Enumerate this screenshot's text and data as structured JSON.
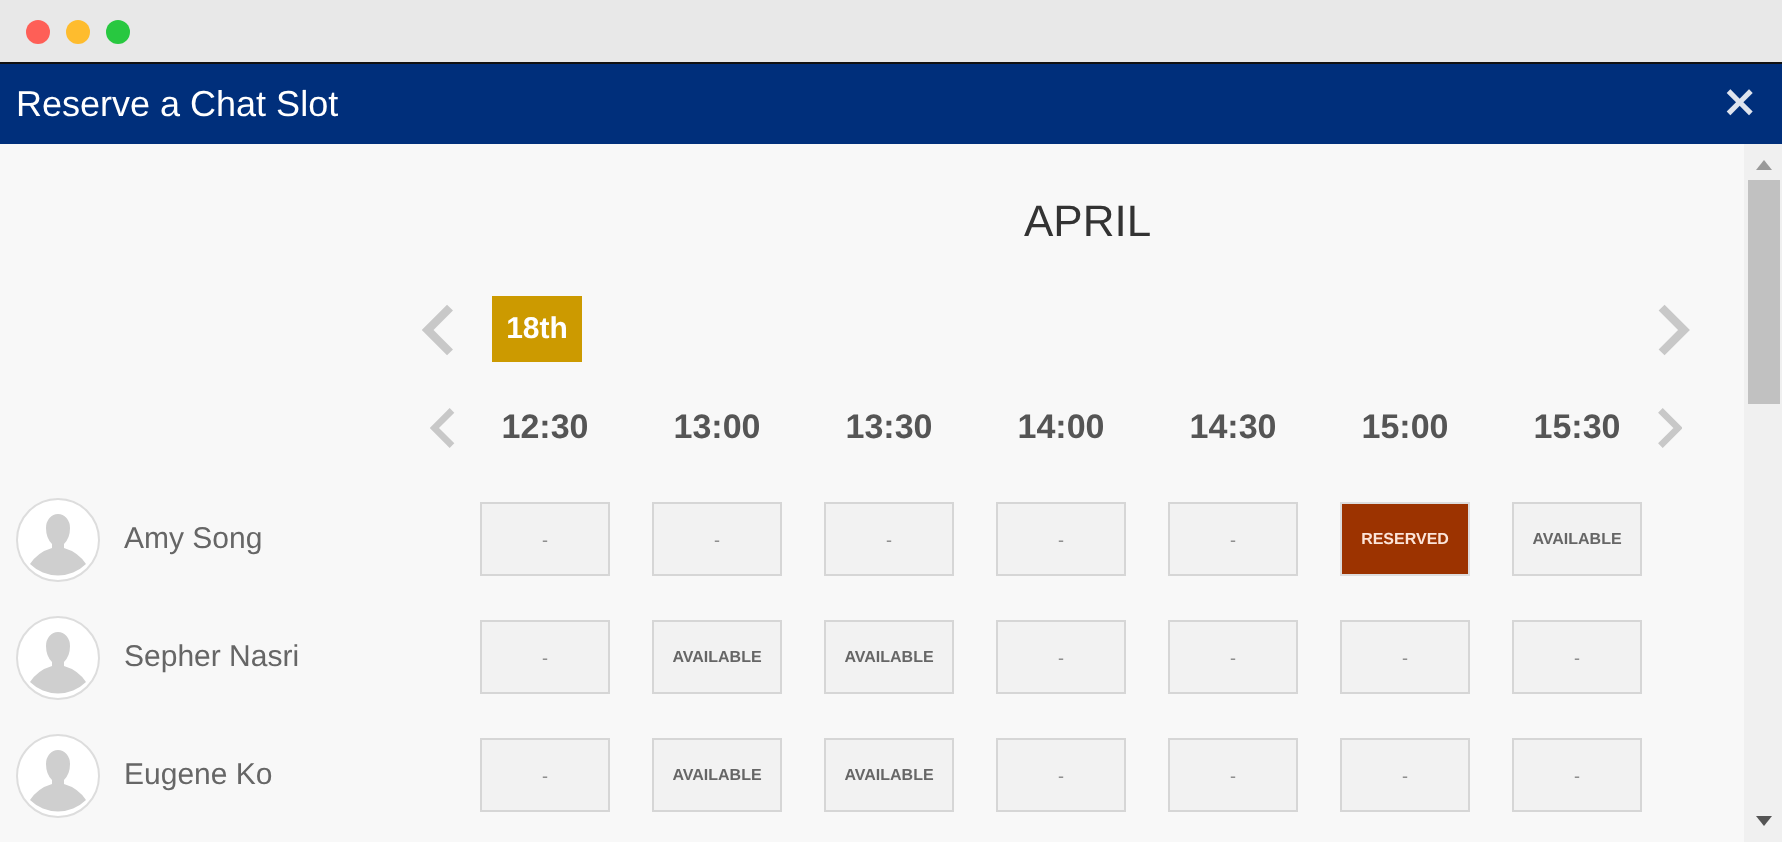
{
  "window": {
    "title": "Reserve a Chat Slot",
    "close": "×"
  },
  "month": "APRIL",
  "days": [
    {
      "label": "18th",
      "selected": true
    }
  ],
  "times": [
    "12:30",
    "13:00",
    "13:30",
    "14:00",
    "14:30",
    "15:00",
    "15:30"
  ],
  "people": [
    {
      "name": "Amy Song",
      "slots": [
        {
          "kind": "empty",
          "text": "-"
        },
        {
          "kind": "empty",
          "text": "-"
        },
        {
          "kind": "empty",
          "text": "-"
        },
        {
          "kind": "empty",
          "text": "-"
        },
        {
          "kind": "empty",
          "text": "-"
        },
        {
          "kind": "reserved",
          "text": "RESERVED"
        },
        {
          "kind": "available",
          "text": "AVAILABLE"
        }
      ]
    },
    {
      "name": "Sepher Nasri",
      "slots": [
        {
          "kind": "empty",
          "text": "-"
        },
        {
          "kind": "available",
          "text": "AVAILABLE"
        },
        {
          "kind": "available",
          "text": "AVAILABLE"
        },
        {
          "kind": "empty",
          "text": "-"
        },
        {
          "kind": "empty",
          "text": "-"
        },
        {
          "kind": "empty",
          "text": "-"
        },
        {
          "kind": "empty",
          "text": "-"
        }
      ]
    },
    {
      "name": "Eugene Ko",
      "slots": [
        {
          "kind": "empty",
          "text": "-"
        },
        {
          "kind": "available",
          "text": "AVAILABLE"
        },
        {
          "kind": "available",
          "text": "AVAILABLE"
        },
        {
          "kind": "empty",
          "text": "-"
        },
        {
          "kind": "empty",
          "text": "-"
        },
        {
          "kind": "empty",
          "text": "-"
        },
        {
          "kind": "empty",
          "text": "-"
        }
      ]
    }
  ]
}
